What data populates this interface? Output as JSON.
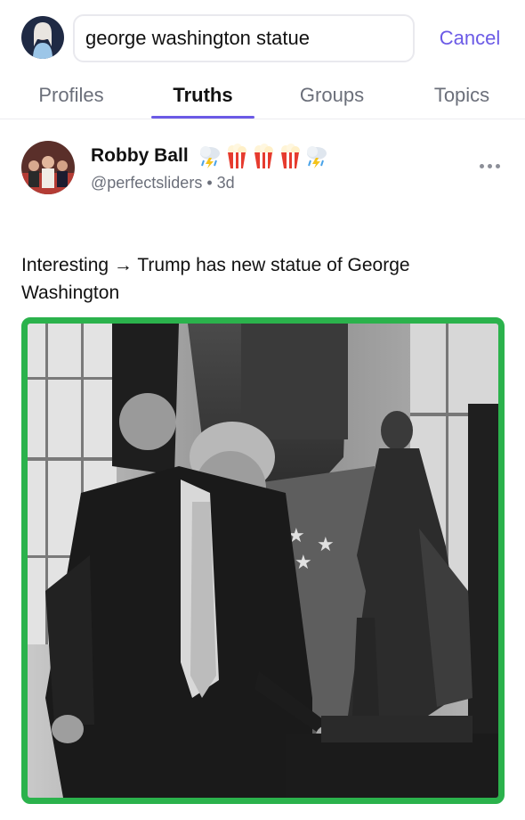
{
  "search": {
    "value": "george washington statue",
    "cancel_label": "Cancel"
  },
  "tabs": [
    {
      "label": "Profiles",
      "active": false
    },
    {
      "label": "Truths",
      "active": true
    },
    {
      "label": "Groups",
      "active": false
    },
    {
      "label": "Topics",
      "active": false
    }
  ],
  "post": {
    "author_name": "Robby Ball",
    "name_badges": [
      "cloud-lightning-emoji",
      "popcorn-emoji",
      "popcorn-emoji",
      "popcorn-emoji",
      "cloud-lightning-emoji"
    ],
    "handle_time": "@perfectsliders • 3d",
    "text": "Interesting → Trump has new statue of George Washington",
    "media_icon": "photo"
  },
  "colors": {
    "accent": "#6b5ae6",
    "media_border": "#2bb24c",
    "muted_text": "#6b6f7a"
  }
}
